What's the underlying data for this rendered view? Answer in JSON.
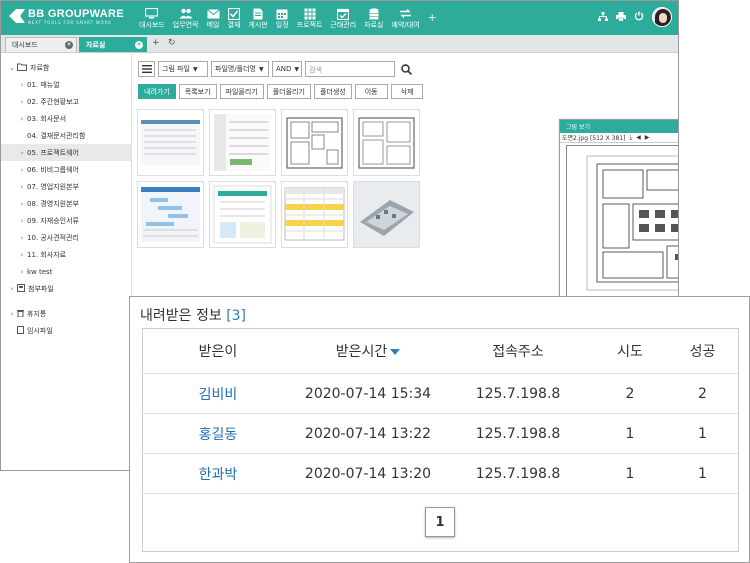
{
  "app": {
    "logo_title": "BB GROUPWARE",
    "logo_subtitle": "NEXT TOOLS FOR SMART WORK",
    "accent_color": "#2dab9b"
  },
  "menu": [
    {
      "label": "대시보드",
      "icon": "monitor-icon"
    },
    {
      "label": "업무연락",
      "icon": "people-icon"
    },
    {
      "label": "메일",
      "icon": "mail-icon"
    },
    {
      "label": "결재",
      "icon": "approval-icon"
    },
    {
      "label": "게시판",
      "icon": "document-icon"
    },
    {
      "label": "일정",
      "icon": "calendar-icon"
    },
    {
      "label": "프로젝트",
      "icon": "grid-icon"
    },
    {
      "label": "근태관리",
      "icon": "calendar-check-icon"
    },
    {
      "label": "자료실",
      "icon": "database-icon"
    },
    {
      "label": "예약/대여",
      "icon": "swap-icon"
    }
  ],
  "tabs": [
    {
      "label": "대시보드",
      "active": false
    },
    {
      "label": "자료실",
      "active": true
    }
  ],
  "sidebar": {
    "root": "자료함",
    "items": [
      {
        "label": "01. 매뉴얼",
        "arrow": true,
        "selected": false
      },
      {
        "label": "02. 주간현황보고",
        "arrow": true,
        "selected": false
      },
      {
        "label": "03. 회사문서",
        "arrow": true,
        "selected": false
      },
      {
        "label": "04. 결재문서관리함",
        "arrow": false,
        "selected": false
      },
      {
        "label": "05. 프로젝트웨어",
        "arrow": true,
        "selected": true
      },
      {
        "label": "06. 비비그룹웨어",
        "arrow": true,
        "selected": false
      },
      {
        "label": "07. 영업지원본부",
        "arrow": true,
        "selected": false
      },
      {
        "label": "08. 경영지원본부",
        "arrow": true,
        "selected": false
      },
      {
        "label": "09. 자재승인서류",
        "arrow": true,
        "selected": false
      },
      {
        "label": "10. 공사견적관리",
        "arrow": true,
        "selected": false
      },
      {
        "label": "11. 회사자료",
        "arrow": true,
        "selected": false
      },
      {
        "label": "kw test",
        "arrow": true,
        "selected": false
      }
    ],
    "attachments": "첨부파일",
    "trash": "휴지통",
    "temp": "임시파일"
  },
  "toolbar": {
    "view_select": "그림 파일",
    "field_select": "파일명/폴더명",
    "logic_select": "AND",
    "search_placeholder": "검색",
    "buttons": [
      "내려가기",
      "목록보기",
      "파일올리기",
      "폴더올리기",
      "폴더생성",
      "이동",
      "삭제"
    ]
  },
  "viewer": {
    "title": "그림 보기",
    "filename": "도면2.jpg [512 X 381]"
  },
  "downloads": {
    "title": "내려받은 정보",
    "count": "[3]",
    "headers": [
      "받은이",
      "받은시간",
      "접속주소",
      "시도",
      "성공"
    ],
    "rows": [
      {
        "name": "김비비",
        "time": "2020-07-14 15:34",
        "ip": "125.7.198.8",
        "tries": "2",
        "success": "2"
      },
      {
        "name": "홍길동",
        "time": "2020-07-14 13:22",
        "ip": "125.7.198.8",
        "tries": "1",
        "success": "1"
      },
      {
        "name": "한과박",
        "time": "2020-07-14 13:20",
        "ip": "125.7.198.8",
        "tries": "1",
        "success": "1"
      }
    ],
    "page": "1"
  }
}
